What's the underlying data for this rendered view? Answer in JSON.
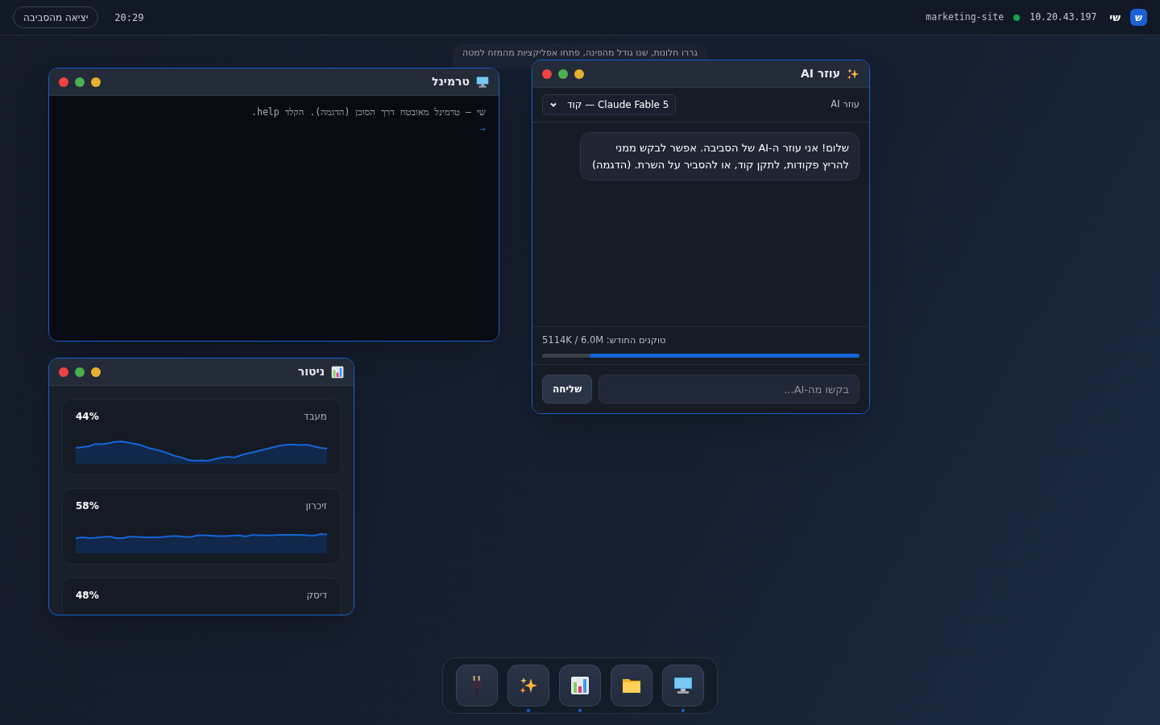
{
  "topbar": {
    "logo": "ש",
    "user": "שי",
    "ip": "10.20.43.197",
    "env": {
      "name": "marketing-site",
      "online": true
    },
    "time": "20:29",
    "exit_button": "יציאה מהסביבה"
  },
  "hint": "גררו חלונות, שנו גודל מהפינה, פתחו אפליקציות מהמזח למטה",
  "terminal": {
    "title": "טרמינל",
    "lines": [
      "שי — טרמינל מאובטח דרך הסוכן (הדגמה). הקלד help."
    ],
    "prompt": "→"
  },
  "monitor": {
    "title": "ניטור",
    "metrics": [
      {
        "label": "מעבד",
        "value": "44%",
        "kind": "wave"
      },
      {
        "label": "זיכרון",
        "value": "58%",
        "kind": "flat"
      },
      {
        "label": "דיסק",
        "value": "48%"
      }
    ]
  },
  "assistant": {
    "title": "עוזר AI",
    "subtitle": "עוזר AI",
    "model": "Claude Fable 5 — קוד",
    "messages": [
      {
        "text": "שלום! אני עוזר ה-AI של הסביבה. אפשר לבקש ממני להריץ פקודות, לתקן קוד, או להסביר על השרת. (הדגמה)"
      }
    ],
    "usage": "טוקנים החודש: 5114K / 6.0M",
    "level": 0.85,
    "placeholder": "בקשו מה-AI...",
    "send": "שליחה"
  },
  "dock": [
    {
      "kind": "plug",
      "running": false
    },
    {
      "kind": "sparkle",
      "running": true
    },
    {
      "kind": "chart",
      "running": true
    },
    {
      "kind": "folder",
      "running": false
    },
    {
      "kind": "monitor",
      "running": true
    }
  ]
}
